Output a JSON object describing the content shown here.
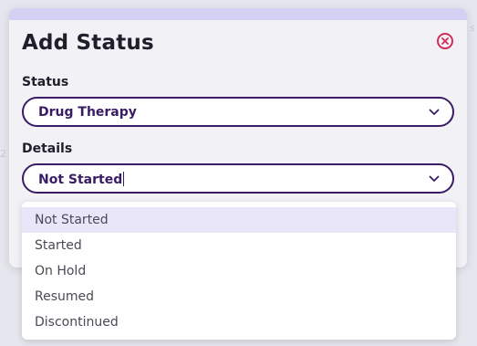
{
  "modal": {
    "title": "Add Status",
    "status_label": "Status",
    "status_value": "Drug Therapy",
    "details_label": "Details",
    "details_value": "Not Started"
  },
  "dropdown": {
    "options": [
      "Not Started",
      "Started",
      "On Hold",
      "Resumed",
      "Discontinued"
    ],
    "selected": "Not Started"
  },
  "colors": {
    "accent": "#3a1c66",
    "close": "#cc2f5a",
    "highlight": "#e9e6fa",
    "topbar": "#d4d0f3"
  }
}
